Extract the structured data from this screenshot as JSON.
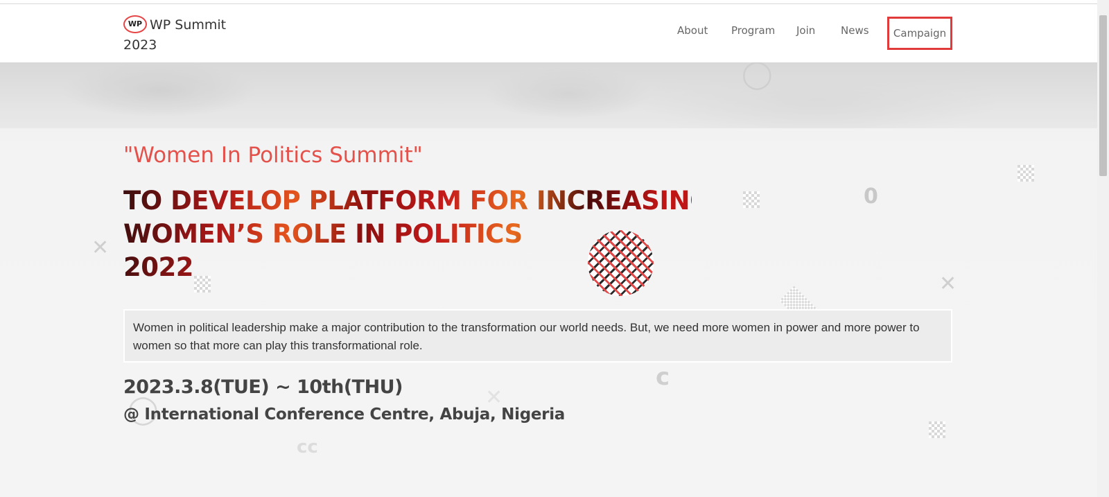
{
  "header": {
    "logo_badge": "WP",
    "logo_line1": "WP Summit",
    "logo_line2": "2023",
    "nav": [
      "About",
      "Program",
      "Join",
      "News",
      "Campaign"
    ]
  },
  "hero": {
    "subtitle": "\"Women In Politics Summit\"",
    "headline": [
      "TO DEVELOP PLATFORM FOR INCREASING",
      "WOMEN’S ROLE IN POLITICS",
      "2022"
    ],
    "description": "Women in political leadership make a major contribution to the transformation our world needs. But, we need more women in power and more power to women so that more can play this transformational role.",
    "date": "2023.3.8(TUE) ~ 10th(THU)",
    "venue": "@ International Conference Centre, Abuja, Nigeria"
  },
  "colors": {
    "accent": "#e4514a",
    "highlight_border": "#e03a3a",
    "text": "#333333"
  }
}
